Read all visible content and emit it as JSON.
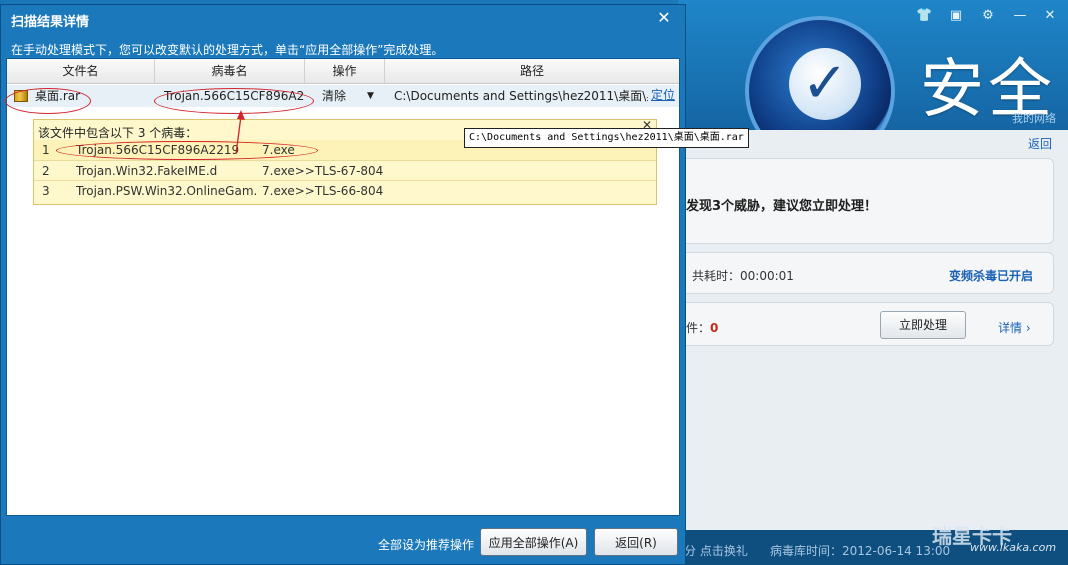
{
  "background": {
    "safe_label": "安全",
    "my_network": "我的网络",
    "return": "返回",
    "threat_message": "发现3个威胁，建议您立即处理！",
    "elapsed": "共耗时：00:00:01",
    "freq_kill": "变频杀毒已开启",
    "count_prefix": "件：",
    "count_value": "0",
    "fix_now": "立即处理",
    "details": "详情 ›",
    "status_left": "分 点击换礼",
    "status_db": "病毒库时间：2012-06-14 13:00",
    "watermark": "瑞星卡卡",
    "watermark_url": "www.ikaka.com"
  },
  "dialog": {
    "title": "扫描结果详情",
    "info": "在手动处理模式下，您可以改变默认的处理方式，单击“应用全部操作”完成处理。",
    "columns": [
      "文件名",
      "病毒名",
      "操作",
      "路径"
    ],
    "row": {
      "file": "桌面.rar",
      "virus": "Trojan.566C15CF896A2...",
      "action": "清除",
      "path": "C:\\Documents and Settings\\hez2011\\桌面\\桌",
      "locate": "定位"
    },
    "popup": {
      "header": "该文件中包含以下  3 个病毒：",
      "viruses": [
        {
          "num": "1",
          "name": "Trojan.566C15CF896A2219",
          "file": "7.exe"
        },
        {
          "num": "2",
          "name": "Trojan.Win32.FakeIME.d",
          "file": "7.exe>>TLS-67-804"
        },
        {
          "num": "3",
          "name": "Trojan.PSW.Win32.OnlineGam...",
          "file": "7.exe>>TLS-66-804"
        }
      ]
    },
    "tooltip": "C:\\Documents and Settings\\hez2011\\桌面\\桌面.rar",
    "footer_label": "全部设为推荐操作",
    "apply_all": "应用全部操作(A)",
    "back": "返回(R)"
  },
  "colors": {
    "dialog_blue": "#1b79bb",
    "link_blue": "#1b62b5",
    "annotation_red": "#d2242a",
    "popup_yellow": "#fef8cc"
  }
}
